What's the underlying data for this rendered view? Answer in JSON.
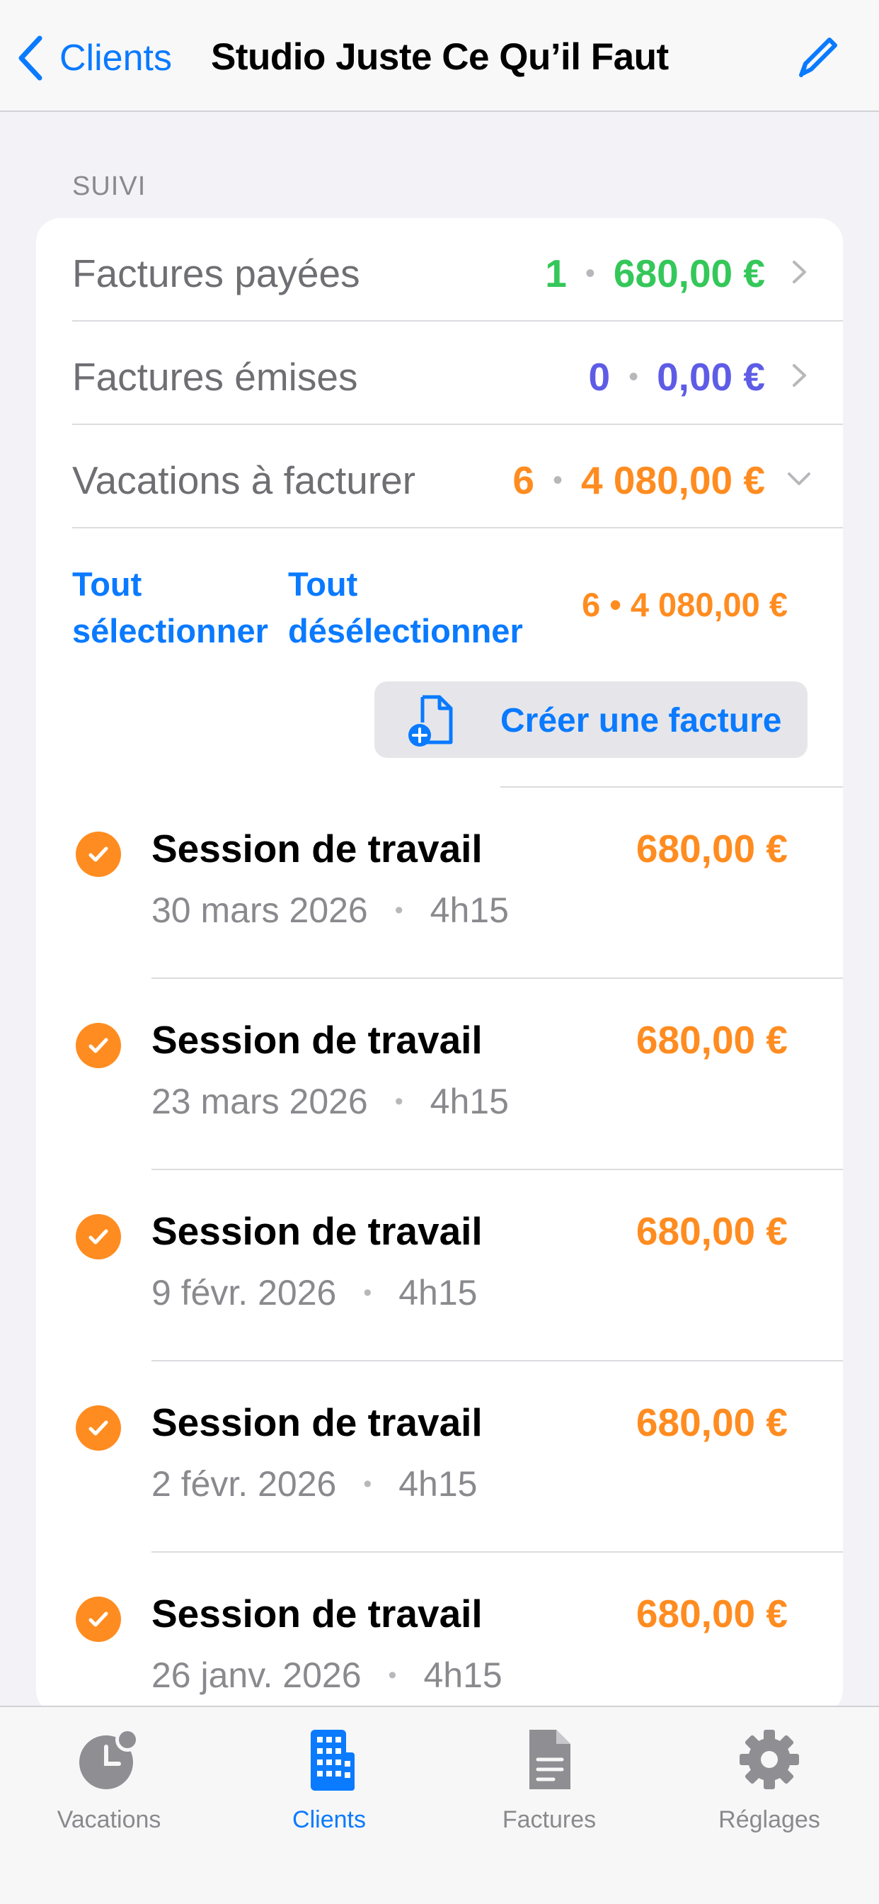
{
  "nav": {
    "back_label": "Clients",
    "title": "Studio Juste Ce Qu’il Faut"
  },
  "section": {
    "header": "SUIVI"
  },
  "summary": [
    {
      "label": "Factures payées",
      "count": "1",
      "amount": "680,00 €",
      "color": "#34c759",
      "indicator": "chevron-right-icon"
    },
    {
      "label": "Factures émises",
      "count": "0",
      "amount": "0,00 €",
      "color": "#5e5ce6",
      "indicator": "chevron-right-icon"
    },
    {
      "label": "Vacations à facturer",
      "count": "6",
      "amount": "4 080,00 €",
      "color": "#ff8c20",
      "indicator": "chevron-down-icon"
    }
  ],
  "selection": {
    "select_all_line1": "Tout",
    "select_all_line2": "sélectionner",
    "deselect_all_line1": "Tout",
    "deselect_all_line2": "désélectionner",
    "total": "6 • 4 080,00 €"
  },
  "create_invoice": {
    "label": "Créer une facture",
    "icon": "document-add-icon"
  },
  "sessions": [
    {
      "title": "Session de travail",
      "date": "30 mars 2026",
      "duration": "4h15",
      "amount": "680,00 €",
      "checked": true
    },
    {
      "title": "Session de travail",
      "date": "23 mars 2026",
      "duration": "4h15",
      "amount": "680,00 €",
      "checked": true
    },
    {
      "title": "Session de travail",
      "date": "9 févr. 2026",
      "duration": "4h15",
      "amount": "680,00 €",
      "checked": true
    },
    {
      "title": "Session de travail",
      "date": "2 févr. 2026",
      "duration": "4h15",
      "amount": "680,00 €",
      "checked": true
    },
    {
      "title": "Session de travail",
      "date": "26 janv. 2026",
      "duration": "4h15",
      "amount": "680,00 €",
      "checked": true
    }
  ],
  "tabs": [
    {
      "label": "Vacations",
      "icon": "clock-badge-icon",
      "active": false
    },
    {
      "label": "Clients",
      "icon": "building-icon",
      "active": true
    },
    {
      "label": "Factures",
      "icon": "document-icon",
      "active": false
    },
    {
      "label": "Réglages",
      "icon": "gear-icon",
      "active": false
    }
  ],
  "colors": {
    "accent": "#0a7aff",
    "paid": "#34c759",
    "issued": "#5e5ce6",
    "to_invoice": "#ff8c20"
  }
}
